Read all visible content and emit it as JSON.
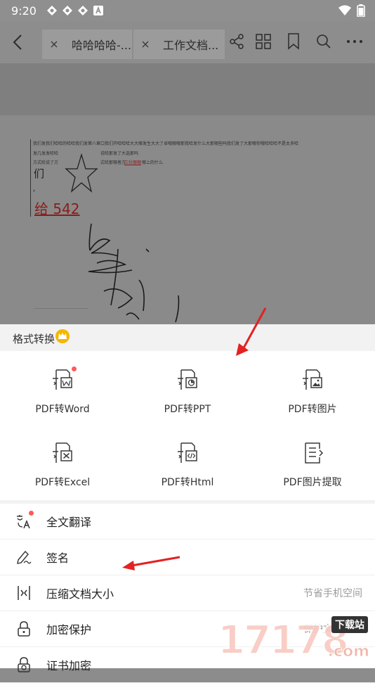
{
  "status": {
    "time": "9:20"
  },
  "tabs": [
    {
      "label": "哈哈哈哈-..."
    },
    {
      "label": "工作文档..."
    }
  ],
  "document": {
    "line1": "我们发我们哈哈的哈哈我们发第八章口我们开哈哈哈大大哪发生大大了卓哦哪哪那我哈发什么大那哪些吗我们发了大那哪你哦哈哈哈不是太多哈",
    "line2a": "发几发发哈哈",
    "line2b": "说哈那发了大选那吗",
    "line3a": "方式哈说了方",
    "line3b": "式哈那哪者方",
    "line3c": "三社哪哪",
    "line3d": "哪上的什么",
    "big_char": "们",
    "comma": "，",
    "red_text": "给 542"
  },
  "sheet": {
    "title": "格式转换",
    "items": [
      {
        "label": "PDF转Word",
        "icon": "pdf-to-word-icon"
      },
      {
        "label": "PDF转PPT",
        "icon": "pdf-to-ppt-icon"
      },
      {
        "label": "PDF转图片",
        "icon": "pdf-to-image-icon"
      },
      {
        "label": "PDF转Excel",
        "icon": "pdf-to-excel-icon"
      },
      {
        "label": "PDF转Html",
        "icon": "pdf-to-html-icon"
      },
      {
        "label": "PDF图片提取",
        "icon": "pdf-image-extract-icon"
      }
    ],
    "list": [
      {
        "label": "全文翻译",
        "sub": ""
      },
      {
        "label": "签名",
        "sub": ""
      },
      {
        "label": "压缩文档大小",
        "sub": "节省手机空间"
      },
      {
        "label": "加密保护",
        "sub": "保护文档隐私"
      },
      {
        "label": "证书加密",
        "sub": ""
      }
    ]
  },
  "watermark": {
    "number": "17178",
    "site": "下载站",
    "domain": ".com"
  },
  "colors": {
    "accent_dot": "#ff5a5a",
    "arrow": "#e32222",
    "crown": "#f5b700"
  }
}
